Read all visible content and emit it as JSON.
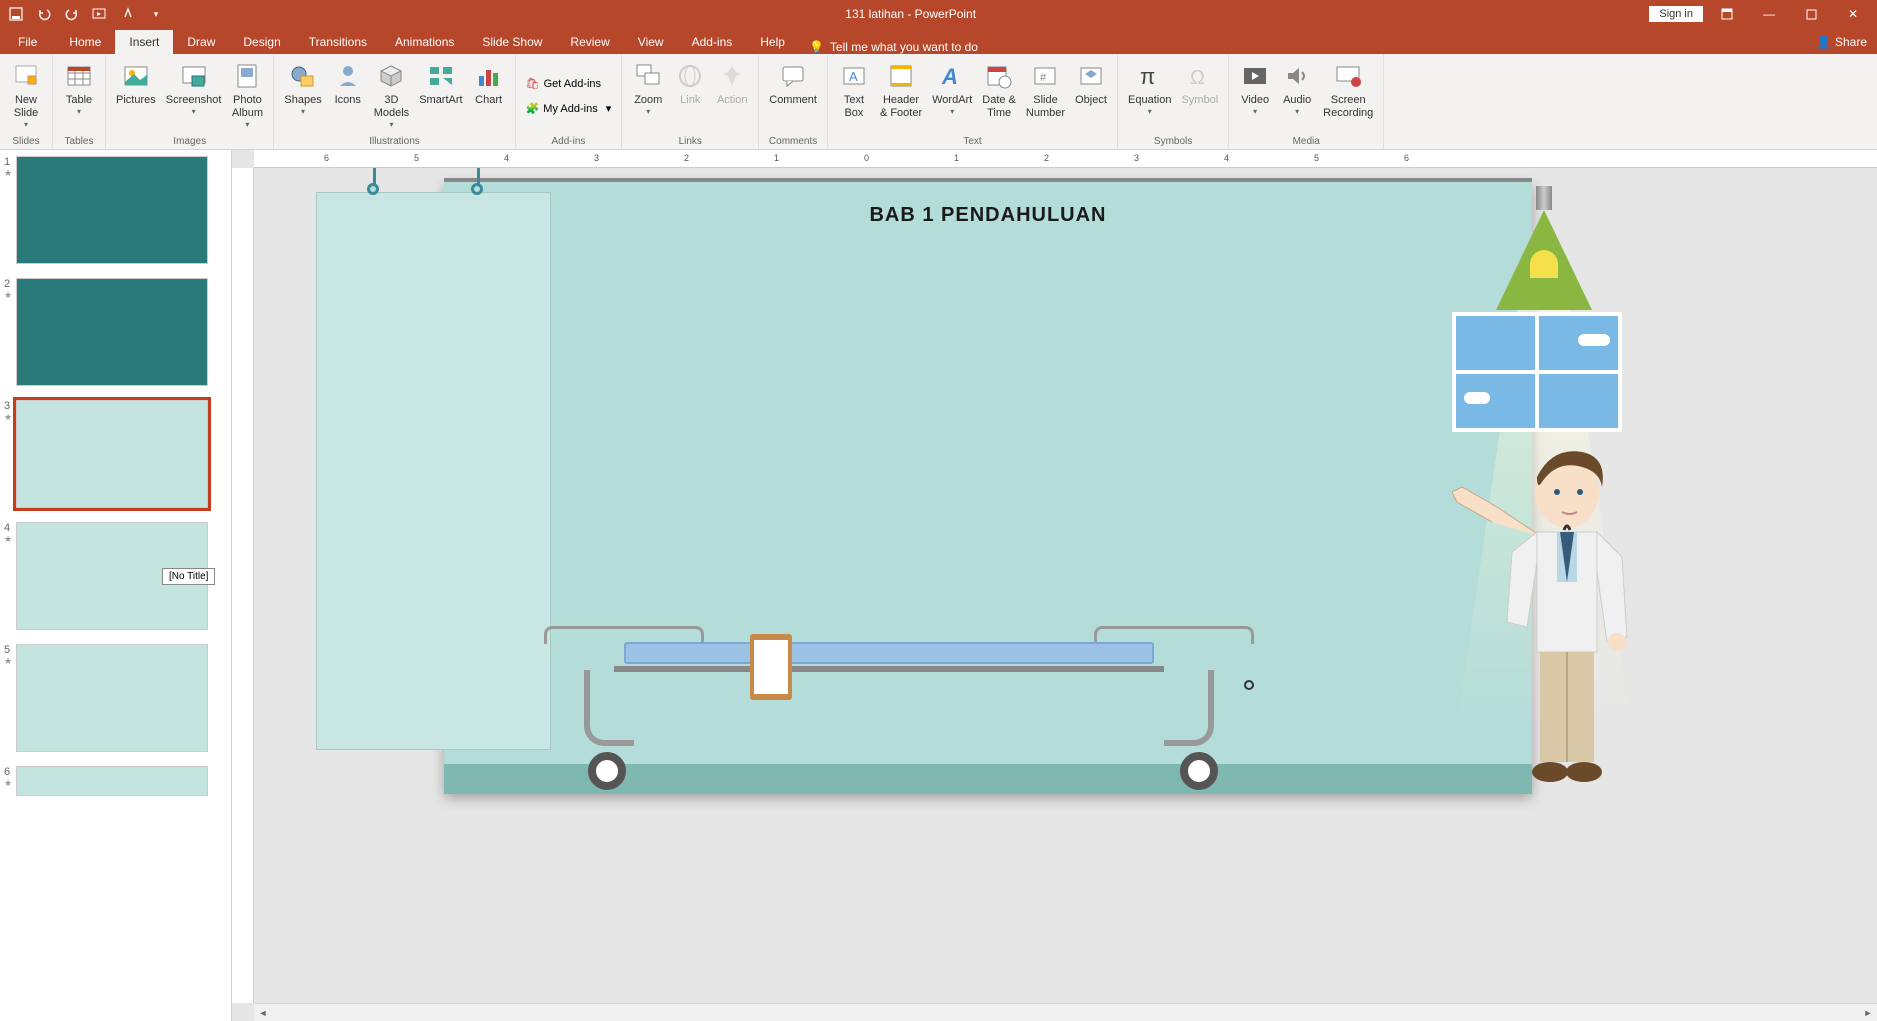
{
  "app": {
    "title": "131 latihan - PowerPoint"
  },
  "titlebar": {
    "signin": "Sign in"
  },
  "tabs": {
    "file": "File",
    "home": "Home",
    "insert": "Insert",
    "draw": "Draw",
    "design": "Design",
    "transitions": "Transitions",
    "animations": "Animations",
    "slideshow": "Slide Show",
    "review": "Review",
    "view": "View",
    "addins_tab": "Add-ins",
    "help": "Help",
    "tellme": "Tell me what you want to do",
    "share": "Share"
  },
  "ribbon": {
    "groups": {
      "slides": "Slides",
      "tables": "Tables",
      "images": "Images",
      "illustrations": "Illustrations",
      "addins": "Add-ins",
      "links": "Links",
      "comments": "Comments",
      "text": "Text",
      "symbols": "Symbols",
      "media": "Media"
    },
    "new_slide": "New\nSlide",
    "table": "Table",
    "pictures": "Pictures",
    "screenshot": "Screenshot",
    "photo_album": "Photo\nAlbum",
    "shapes": "Shapes",
    "icons": "Icons",
    "models3d": "3D\nModels",
    "smartart": "SmartArt",
    "chart": "Chart",
    "get_addins": "Get Add-ins",
    "my_addins": "My Add-ins",
    "zoom": "Zoom",
    "link": "Link",
    "action": "Action",
    "comment": "Comment",
    "text_box": "Text\nBox",
    "header_footer": "Header\n& Footer",
    "wordart": "WordArt",
    "date_time": "Date &\nTime",
    "slide_number": "Slide\nNumber",
    "object": "Object",
    "equation": "Equation",
    "symbol": "Symbol",
    "video": "Video",
    "audio": "Audio",
    "screen_recording": "Screen\nRecording"
  },
  "thumbnails": {
    "tooltip": "[No Title]",
    "nums": [
      "1",
      "2",
      "3",
      "4",
      "5",
      "6"
    ]
  },
  "slide": {
    "title": "BAB 1 PENDAHULUAN"
  },
  "ruler": {
    "h": [
      "6",
      "5",
      "4",
      "3",
      "2",
      "1",
      "0",
      "1",
      "2",
      "3",
      "4",
      "5",
      "6"
    ]
  }
}
